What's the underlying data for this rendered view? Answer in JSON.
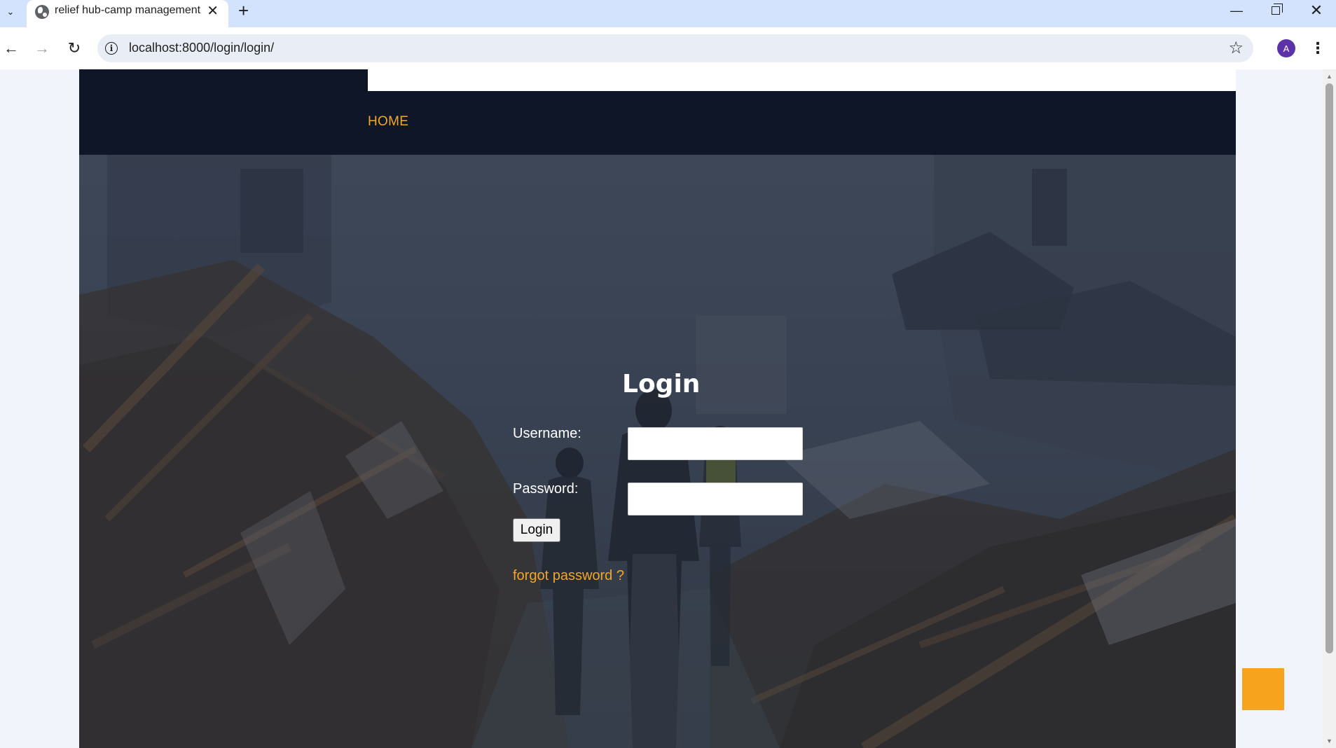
{
  "browser": {
    "tab_title": "relief hub-camp management",
    "url": "localhost:8000/login/login/",
    "avatar_initial": "A",
    "tab_close_glyph": "✕",
    "new_tab_glyph": "+",
    "min_glyph": "—",
    "close_glyph": "✕",
    "back_glyph": "←",
    "forward_glyph": "→",
    "reload_glyph": "↻",
    "star_glyph": "☆",
    "menu_glyph": "⋮",
    "info_glyph": "i",
    "tab_list_glyph": "⌄"
  },
  "site": {
    "nav": {
      "home_label": "HOME"
    },
    "login": {
      "title": "Login",
      "username_label": "Username:",
      "password_label": "Password:",
      "username_value": "",
      "password_value": "",
      "submit_label": "Login",
      "forgot_label": "forgot password ?"
    }
  },
  "colors": {
    "header_bg": "#0e1628",
    "accent": "#f5a623",
    "back_to_top": "#f8a31d",
    "tabstrip": "#d3e3fd"
  },
  "icons": [
    "tab-list-icon",
    "globe-favicon-icon",
    "close-icon",
    "plus-icon",
    "minimize-icon",
    "restore-icon",
    "back-arrow-icon",
    "forward-arrow-icon",
    "reload-icon",
    "info-icon",
    "star-icon",
    "more-vert-icon"
  ]
}
